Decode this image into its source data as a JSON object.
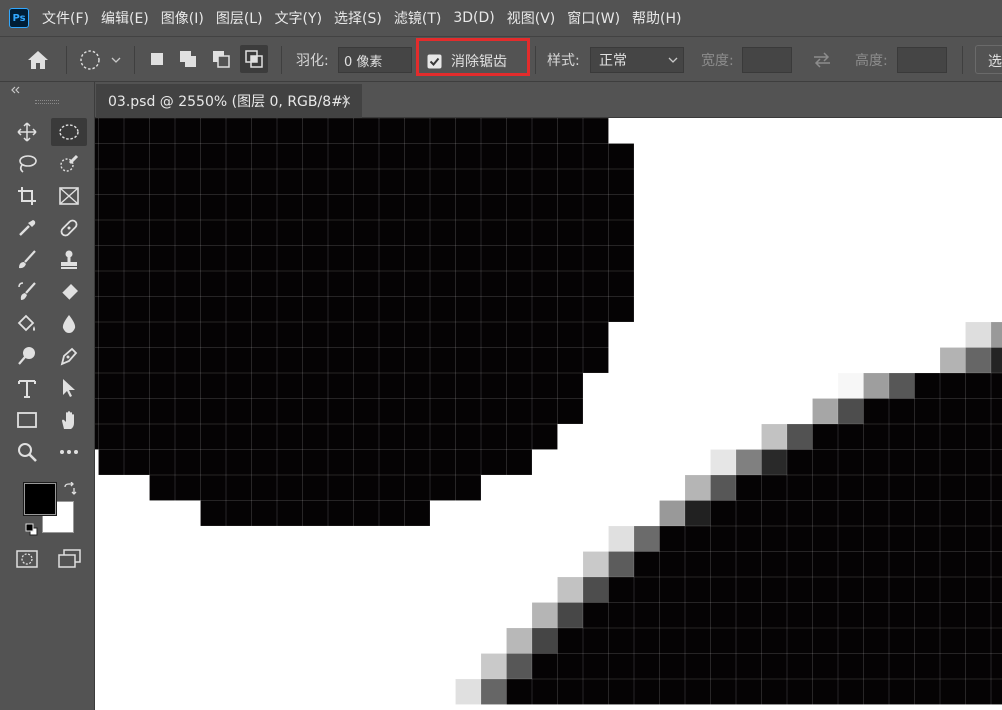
{
  "app": {
    "logo_text": "Ps"
  },
  "menu": [
    "文件(F)",
    "编辑(E)",
    "图像(I)",
    "图层(L)",
    "文字(Y)",
    "选择(S)",
    "滤镜(T)",
    "3D(D)",
    "视图(V)",
    "窗口(W)",
    "帮助(H)"
  ],
  "options": {
    "feather_label": "羽化:",
    "feather_value": "0 像素",
    "antialias_label": "消除锯齿",
    "antialias_checked": true,
    "style_label": "样式:",
    "style_value": "正常",
    "width_label": "宽度:",
    "height_label": "高度:",
    "select_button_label": "选"
  },
  "document": {
    "tab_title": "03.psd @ 2550% (图层 0, RGB/8#)",
    "close_glyph": "×"
  },
  "toolbox": {
    "foreground_color": "#000000",
    "background_color": "#ffffff",
    "tools": [
      "move-tool",
      "elliptical-marquee-tool",
      "lasso-tool",
      "quick-selection-tool",
      "crop-tool",
      "frame-tool",
      "eyedropper-tool",
      "healing-brush-tool",
      "brush-tool",
      "clone-stamp-tool",
      "history-brush-tool",
      "eraser-tool",
      "paint-bucket-tool",
      "blur-tool",
      "dodge-tool",
      "pen-tool",
      "type-tool",
      "path-selection-tool",
      "rectangle-tool",
      "hand-tool",
      "zoom-tool",
      "more-tools"
    ]
  },
  "colors": {
    "ui_bg": "#535353",
    "pixel_black": "#050304",
    "highlight": "#e32c2c"
  },
  "canvas": {
    "zoom_percent": 2550,
    "circle_a_rows": [
      [
        0,
        0,
        19
      ],
      [
        1,
        0,
        20
      ],
      [
        2,
        0,
        20
      ],
      [
        3,
        0,
        20
      ],
      [
        4,
        0,
        20
      ],
      [
        5,
        0,
        20
      ],
      [
        6,
        0,
        20
      ],
      [
        7,
        0,
        20
      ],
      [
        8,
        0,
        19
      ],
      [
        9,
        0,
        19
      ],
      [
        10,
        0,
        18
      ],
      [
        11,
        0,
        18
      ],
      [
        12,
        0,
        17
      ],
      [
        13,
        1,
        16
      ],
      [
        14,
        3,
        14
      ],
      [
        15,
        5,
        12
      ]
    ],
    "circle_b_rows": [
      [
        8,
        [
          [
            34,
            0.87
          ],
          [
            35,
            0.6
          ]
        ]
      ],
      [
        9,
        [
          [
            33,
            0.7
          ],
          [
            34,
            0.4
          ],
          [
            35,
            0.14
          ]
        ]
      ],
      [
        10,
        [
          [
            29,
            0.97
          ],
          [
            30,
            0.62
          ],
          [
            31,
            0.34
          ]
        ]
      ],
      [
        11,
        [
          [
            28,
            0.65
          ],
          [
            29,
            0.3
          ]
        ]
      ],
      [
        12,
        [
          [
            26,
            0.76
          ],
          [
            27,
            0.32
          ]
        ]
      ],
      [
        13,
        [
          [
            24,
            0.9
          ],
          [
            25,
            0.5
          ],
          [
            26,
            0.16
          ]
        ]
      ],
      [
        14,
        [
          [
            23,
            0.71
          ],
          [
            24,
            0.34
          ]
        ]
      ],
      [
        15,
        [
          [
            22,
            0.6
          ],
          [
            23,
            0.13
          ]
        ]
      ],
      [
        16,
        [
          [
            20,
            0.88
          ],
          [
            21,
            0.42
          ]
        ]
      ],
      [
        17,
        [
          [
            19,
            0.79
          ],
          [
            20,
            0.36
          ]
        ]
      ],
      [
        18,
        [
          [
            18,
            0.76
          ],
          [
            19,
            0.3
          ]
        ]
      ],
      [
        19,
        [
          [
            17,
            0.71
          ],
          [
            18,
            0.28
          ]
        ]
      ],
      [
        20,
        [
          [
            16,
            0.72
          ],
          [
            17,
            0.27
          ]
        ]
      ],
      [
        21,
        [
          [
            15,
            0.79
          ],
          [
            16,
            0.34
          ]
        ]
      ],
      [
        22,
        [
          [
            14,
            0.88
          ],
          [
            15,
            0.4
          ]
        ]
      ]
    ]
  }
}
